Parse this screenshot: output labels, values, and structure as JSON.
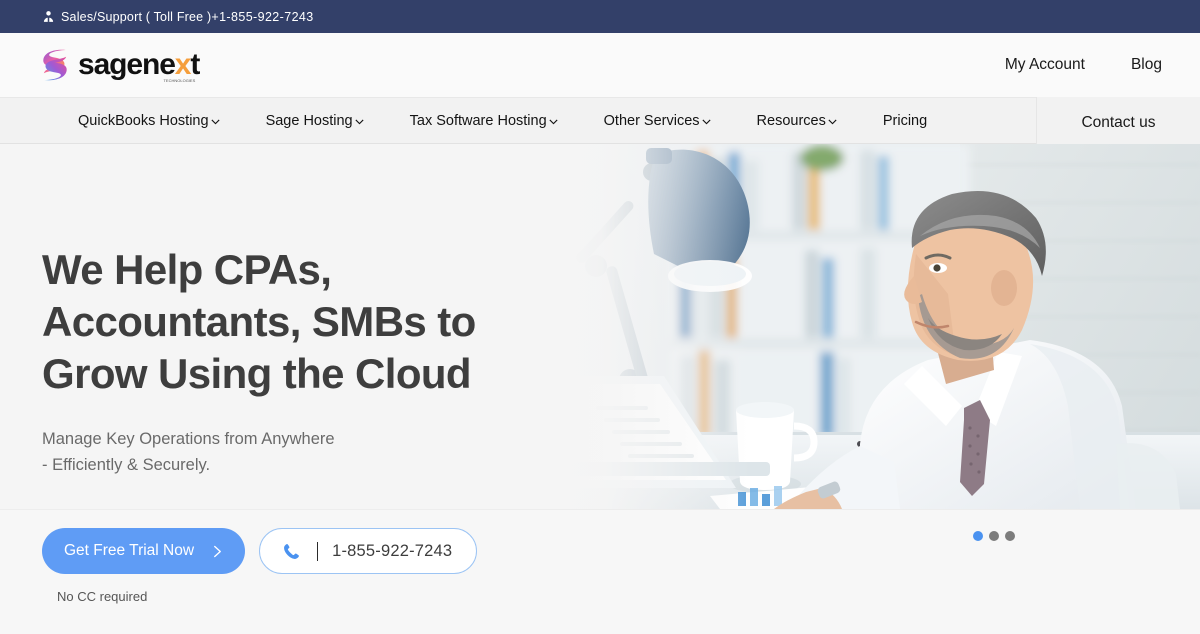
{
  "topbar": {
    "icon": "user-icon",
    "label": "Sales/Support ( Toll Free )",
    "phone": "+1-855-922-7243"
  },
  "header": {
    "logo": {
      "mark": "sagenext-s-swoosh-icon",
      "text_a": "sagene",
      "text_x": "x",
      "text_b": "t",
      "trademark": "TECHNOLOGIES"
    },
    "links": [
      {
        "label": "My Account"
      },
      {
        "label": "Blog"
      }
    ]
  },
  "nav": {
    "items": [
      {
        "label": "QuickBooks Hosting",
        "has_dropdown": true
      },
      {
        "label": "Sage Hosting",
        "has_dropdown": true
      },
      {
        "label": "Tax Software Hosting",
        "has_dropdown": true
      },
      {
        "label": "Other Services",
        "has_dropdown": true
      },
      {
        "label": "Resources",
        "has_dropdown": true
      },
      {
        "label": "Pricing",
        "has_dropdown": false
      }
    ],
    "contact": {
      "label": "Contact us"
    }
  },
  "hero": {
    "title_line1": "We Help CPAs,",
    "title_line2": "Accountants, SMBs to",
    "title_line3": "Grow Using the Cloud",
    "subtitle_line1": "Manage Key Operations from Anywhere",
    "subtitle_line2": "- Efficiently & Securely.",
    "image_alt": "businessman-at-laptop-in-office"
  },
  "cta": {
    "trial_label": "Get Free Trial Now",
    "trial_chevron": "chevron-right-icon",
    "phone_icon": "phone-icon",
    "phone_number": "1-855-922-7243",
    "no_cc_note": "No CC required"
  },
  "carousel": {
    "slides": 3,
    "active_index": 0
  },
  "colors": {
    "topbar_bg": "#334069",
    "nav_bg": "#f2f2f2",
    "page_bg": "#f7f7f7",
    "accent_blue": "#5f9cf5",
    "dot_active": "#4a92f0",
    "dot_inactive": "#7c7c7c",
    "heading": "#3e3e3e",
    "logo_accent": "#f59e3b"
  }
}
